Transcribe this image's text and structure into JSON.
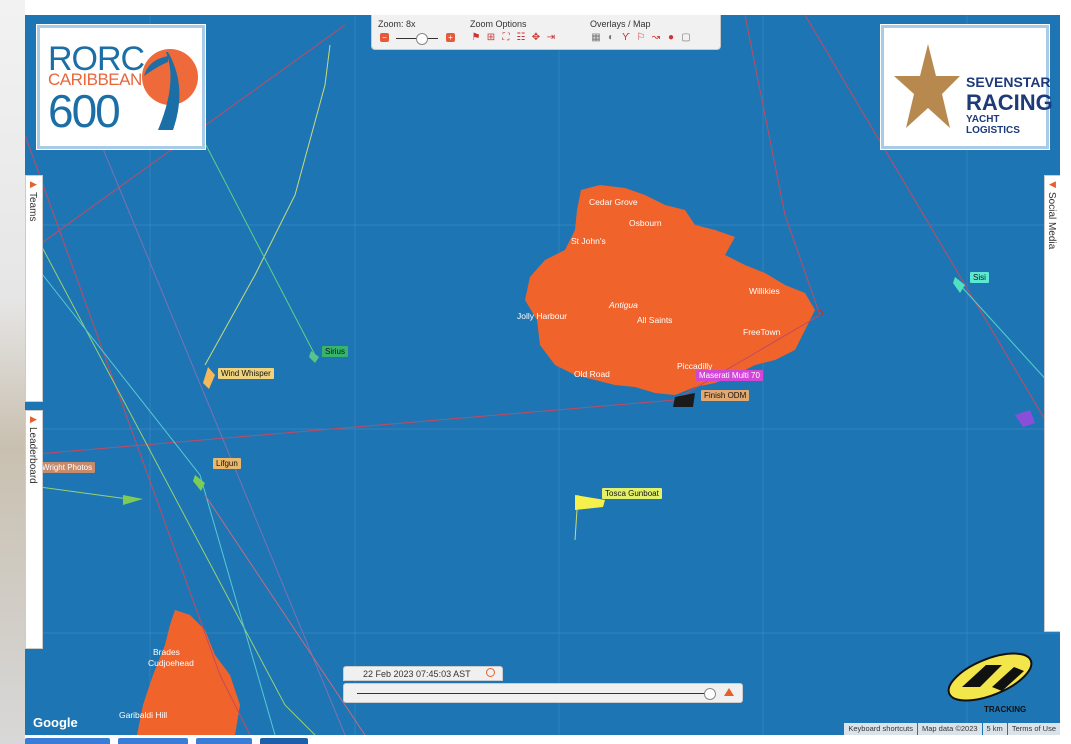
{
  "toolbar": {
    "zoom_label": "Zoom: 8x",
    "zoom_options_label": "Zoom Options",
    "overlays_label": "Overlays / Map"
  },
  "logos": {
    "rorc_line1": "RORC",
    "rorc_line2": "CARIBBEAN",
    "rorc_line3": "600",
    "sevenstar_line1": "SEVENSTAR",
    "sevenstar_line2": "RACING",
    "sevenstar_line3": "YACHT LOGISTICS"
  },
  "side_tabs": {
    "teams": "Teams",
    "leaderboard": "Leaderboard",
    "social": "Social Media"
  },
  "places": {
    "cedar_grove": "Cedar Grove",
    "osbourn": "Osbourn",
    "st_johns": "St John's",
    "willikies": "Willikies",
    "antigua": "Antigua",
    "jolly_harbour": "Jolly Harbour",
    "all_saints": "All Saints",
    "freetown": "FreeTown",
    "piccadilly": "Piccadilly",
    "old_road": "Old Road",
    "brades": "Brades",
    "cudjoehead": "Cudjoehead",
    "garibaldi_hill": "Garibaldi Hill"
  },
  "boats": {
    "sisi": "Sisi",
    "sirius": "Sirius",
    "wind_whisper": "Wind Whisper",
    "maserati": "Maserati Multi 70",
    "finish": "Finish ODM",
    "wright": "Wright Photos",
    "lifgun": "Lifgun",
    "tosca": "Tosca Gunboat"
  },
  "timebar": {
    "datetime": "22 Feb 2023 07:45:03 AST"
  },
  "footer": {
    "google": "Google",
    "shortcuts": "Keyboard shortcuts",
    "mapdata": "Map data ©2023",
    "scale": "5 km",
    "terms": "Terms of Use"
  },
  "yb_text": "TRACKING",
  "colors": {
    "sea": "#1d76b3",
    "land": "#f0642b",
    "accent": "#e4602e"
  }
}
